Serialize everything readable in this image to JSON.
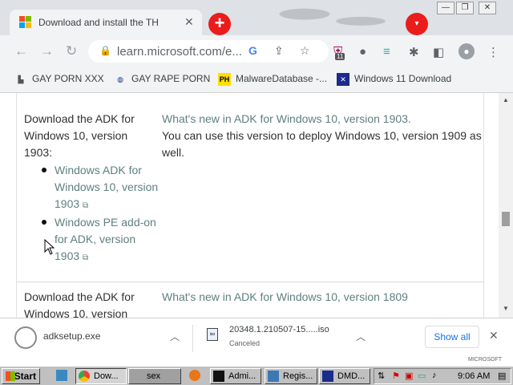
{
  "tab": {
    "title": "Download and install the THIS IS C",
    "close": "✕"
  },
  "newtab_label": "+",
  "toolbar": {
    "back": "←",
    "forward": "→",
    "reload": "↻",
    "lock": "🔒",
    "url": "learn.microsoft.com/e...",
    "ext_badge": "11"
  },
  "bookmarks": [
    {
      "label": "GAY PORN XXX"
    },
    {
      "label": "GAY RAPE PORN"
    },
    {
      "label": "MalwareDatabase -..."
    },
    {
      "label": "Windows 11 Download"
    }
  ],
  "bookmark_icons": [
    "PH"
  ],
  "rows": [
    {
      "left_text": "Download the ADK for Windows 10, version 1903:",
      "links": [
        "Windows ADK for Windows 10, version 1903",
        "Windows PE add-on for ADK, version 1903"
      ],
      "ext_mark": "⧉",
      "right_link": "What's new in ADK for Windows 10, version 1903.",
      "right_text": "You can use this version to deploy Windows 10, version 1909 as well."
    },
    {
      "left_text": "Download the ADK for Windows 10, version",
      "right_link": "What's new in ADK for Windows 10, version 1809"
    }
  ],
  "downloads": {
    "item1": "adksetup.exe",
    "item2": "20348.1.210507-15.....iso",
    "item2_status": "Canceled",
    "item2_badge": "iso",
    "show_all": "Show all",
    "close": "✕"
  },
  "taskbar": {
    "start": "Start",
    "buttons": [
      "Dow...",
      "sex",
      "Admi...",
      "Regis...",
      "DMD..."
    ],
    "clock": "9:06 AM"
  },
  "watermark": "MICROSOFT"
}
